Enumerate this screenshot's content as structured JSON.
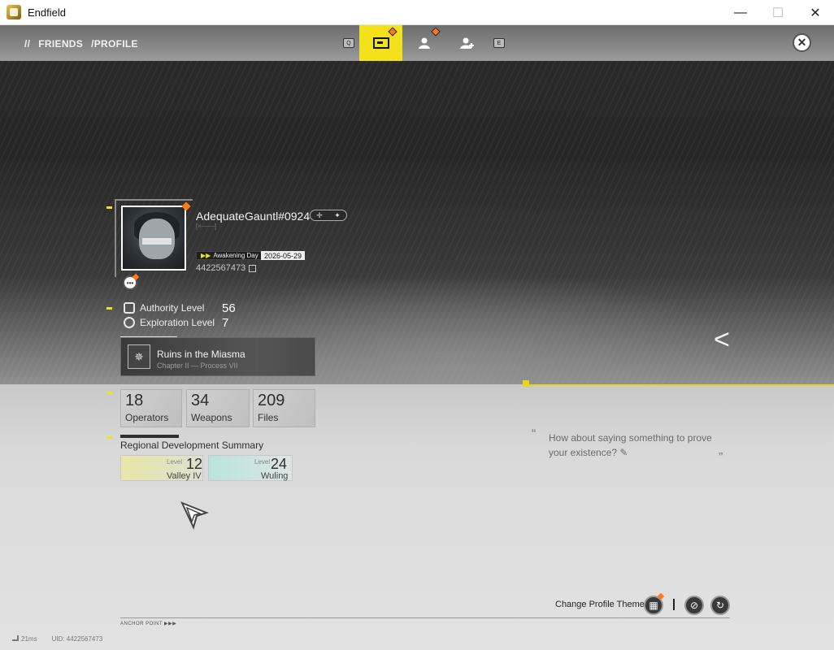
{
  "window": {
    "title": "Endfield",
    "minimize": "—",
    "maximize": "☐",
    "close": "✕"
  },
  "breadcrumb": {
    "prefix": "//",
    "friends": "FRIENDS",
    "profile": "/PROFILE"
  },
  "tabs": {
    "left_key": "Q",
    "right_key": "E"
  },
  "close_button": "✕",
  "profile": {
    "username": "AdequateGauntl#0924",
    "name_sub": "[×——]",
    "awakening_label": "Awakening Day",
    "awakening_date": "2026-05-29",
    "uid": "4422567473",
    "badge": "•••",
    "authority_label": "Authority Level",
    "authority_value": "56",
    "exploration_label": "Exploration Level",
    "exploration_value": "7"
  },
  "mission": {
    "title": "Ruins in the Miasma",
    "subtitle": "Chapter II — Process VII"
  },
  "stats": [
    {
      "value": "18",
      "label": "Operators"
    },
    {
      "value": "34",
      "label": "Weapons"
    },
    {
      "value": "209",
      "label": "Files"
    }
  ],
  "regional": {
    "title": "Regional Development Summary",
    "regions": [
      {
        "level_label": "Level",
        "level": "12",
        "name": "Valley IV"
      },
      {
        "level_label": "Level",
        "level": "24",
        "name": "Wuling"
      }
    ]
  },
  "quote": {
    "open": "“",
    "text": "How about saying something to prove your existence? ✎",
    "close": "”"
  },
  "bottom": {
    "theme_label": "Change Profile Theme",
    "anchor": "ANCHOR POINT ▶▶▶"
  },
  "status": {
    "ping": "21ms",
    "uid": "UID: 4422567473"
  },
  "colors": {
    "accent": "#f3e21b",
    "notify": "#ff7a1a"
  }
}
